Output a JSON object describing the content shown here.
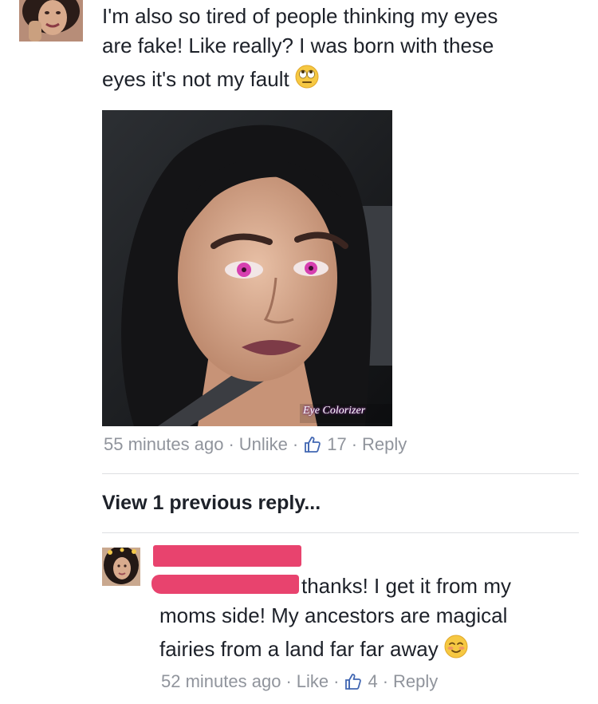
{
  "colors": {
    "text": "#1d2129",
    "meta": "#90949c",
    "divider": "#dddfe2",
    "redaction": "#e8436e",
    "like_blue": "#4267b2",
    "eye_pink": "#d63fb0"
  },
  "comment": {
    "text_lines": [
      "I'm also so tired of people thinking my eyes",
      "are fake! Like really? I was born with these",
      "eyes it's not my fault"
    ],
    "emoji_icon": "rolling-eyes-emoji-icon",
    "photo_watermark": "Eye Colorizer",
    "meta": {
      "time": "55 minutes ago",
      "action": "Unlike",
      "like_icon": "thumbs-up-icon",
      "likes": "17",
      "reply": "Reply"
    }
  },
  "view_previous": "View 1 previous reply...",
  "reply": {
    "text_line1": "thanks! I get it from my",
    "text_line2": "moms side! My ancestors are magical",
    "text_line3": "fairies from a land far far away",
    "emoji_icon": "smiling-blush-emoji-icon",
    "meta": {
      "time": "52 minutes ago",
      "action": "Like",
      "like_icon": "thumbs-up-icon",
      "likes": "4",
      "reply": "Reply"
    }
  }
}
